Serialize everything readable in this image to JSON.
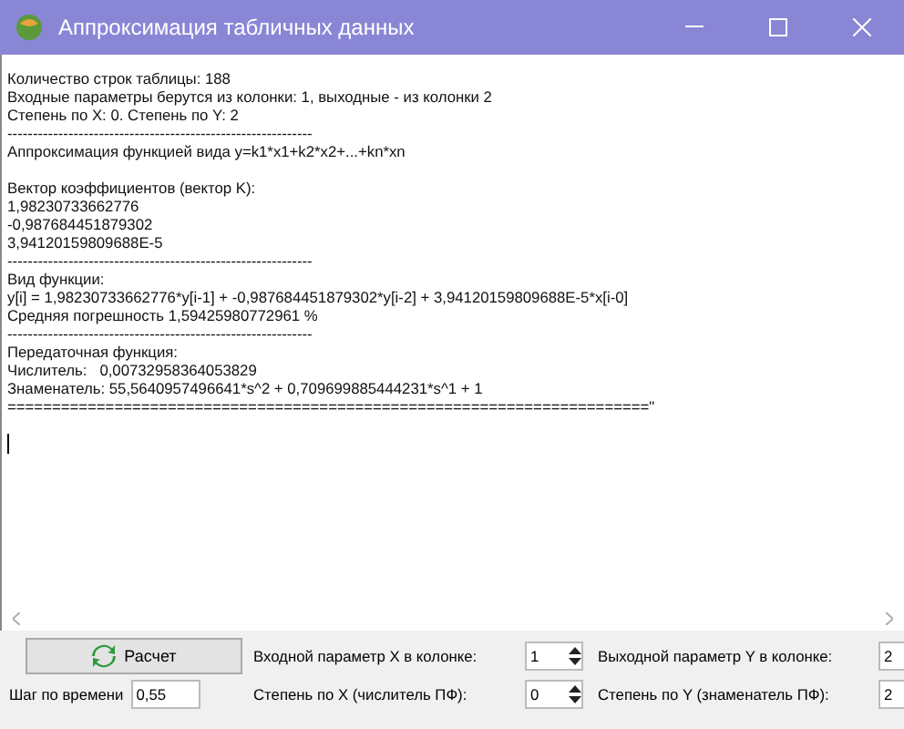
{
  "window": {
    "title": "Аппроксимация  табличных данных"
  },
  "output": {
    "paragraphs": [
      [
        "Количество строк таблицы: 188",
        "Входные параметры берутся из колонки: 1, выходные - из колонки 2",
        "Степень по X: 0. Степень по Y: 2",
        "------------------------------------------------------------",
        "Аппроксимация функцией вида y=k1*x1+k2*x2+...+kn*xn"
      ],
      [
        "Вектор коэффициентов (вектор K):",
        "1,98230733662776",
        "-0,987684451879302",
        "3,94120159809688E-5",
        "------------------------------------------------------------",
        "Вид функции:",
        "y[i] = 1,98230733662776*y[i-1] + -0,987684451879302*y[i-2] + 3,94120159809688E-5*x[i-0]",
        "Средняя погрешность 1,59425980772961 %",
        "------------------------------------------------------------",
        "Передаточная функция:",
        "Числитель:   0,00732958364053829",
        "Знаменатель: 55,5640957496641*s^2 + 0,709699885444231*s^1 + 1",
        "========================================================================\""
      ]
    ]
  },
  "controls": {
    "calc_button": "Расчет",
    "time_step": {
      "label": "Шаг по времени",
      "value": "0,55"
    },
    "spinners": [
      {
        "label": "Входной параметр X в колонке:",
        "value": "1"
      },
      {
        "label": "Выходной параметр Y в колонке:",
        "value": "2"
      },
      {
        "label": "Степень по X (числитель ПФ):",
        "value": "0"
      },
      {
        "label": "Степень по Y (знаменатель ПФ):",
        "value": "2"
      }
    ]
  }
}
